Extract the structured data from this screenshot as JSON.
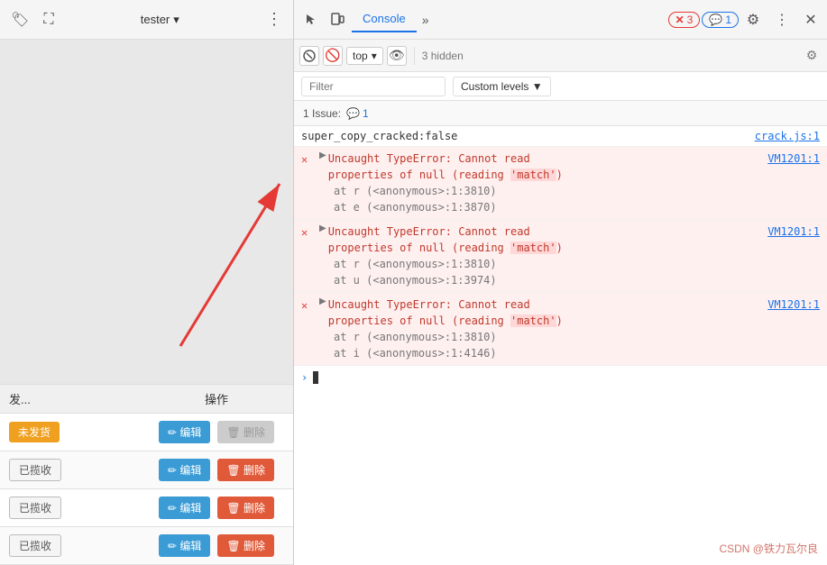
{
  "left_panel": {
    "user_label": "tester",
    "table": {
      "col_fa": "发...",
      "col_op": "操作",
      "rows": [
        {
          "status": "未发货",
          "status_type": "unshipped",
          "edit": "✏ 编辑",
          "delete": "🗑 删除",
          "delete_disabled": true
        },
        {
          "status": "已揽收",
          "status_type": "received",
          "edit": "✏ 编辑",
          "delete": "🗑 删除",
          "delete_disabled": false
        },
        {
          "status": "已揽收",
          "status_type": "received",
          "edit": "✏ 编辑",
          "delete": "🗑 删除",
          "delete_disabled": false
        },
        {
          "status": "已揽收",
          "status_type": "received",
          "edit": "✏ 编辑",
          "delete": "🗑 删除",
          "delete_disabled": false
        }
      ]
    }
  },
  "devtools": {
    "tab_label": "Console",
    "error_count": "3",
    "info_count": "1",
    "top_label": "top",
    "hidden_count": "3 hidden",
    "filter_placeholder": "Filter",
    "custom_levels_label": "Custom levels ▼",
    "issues_label": "1 Issue:",
    "issues_count": "1",
    "console_lines": [
      {
        "type": "info",
        "text": "super_copy_cracked:false",
        "link": "crack.js:1"
      },
      {
        "type": "error",
        "main": "▶ Uncaught TypeError: Cannot read properties of null (reading 'match')",
        "stack": [
          "at r (<anonymous>:1:3810)",
          "at e (<anonymous>:1:3870)"
        ],
        "link": "VM1201:1"
      },
      {
        "type": "error",
        "main": "▶ Uncaught TypeError: Cannot read properties of null (reading 'match')",
        "stack": [
          "at r (<anonymous>:1:3810)",
          "at u (<anonymous>:1:3974)"
        ],
        "link": "VM1201:1"
      },
      {
        "type": "error",
        "main": "▶ Uncaught TypeError: Cannot read properties of null (reading 'match')",
        "stack": [
          "at r (<anonymous>:1:3810)",
          "at i (<anonymous>:1:4146)"
        ],
        "link": "VM1201:1"
      }
    ],
    "watermark": "CSDN @铁力瓦尔良"
  }
}
